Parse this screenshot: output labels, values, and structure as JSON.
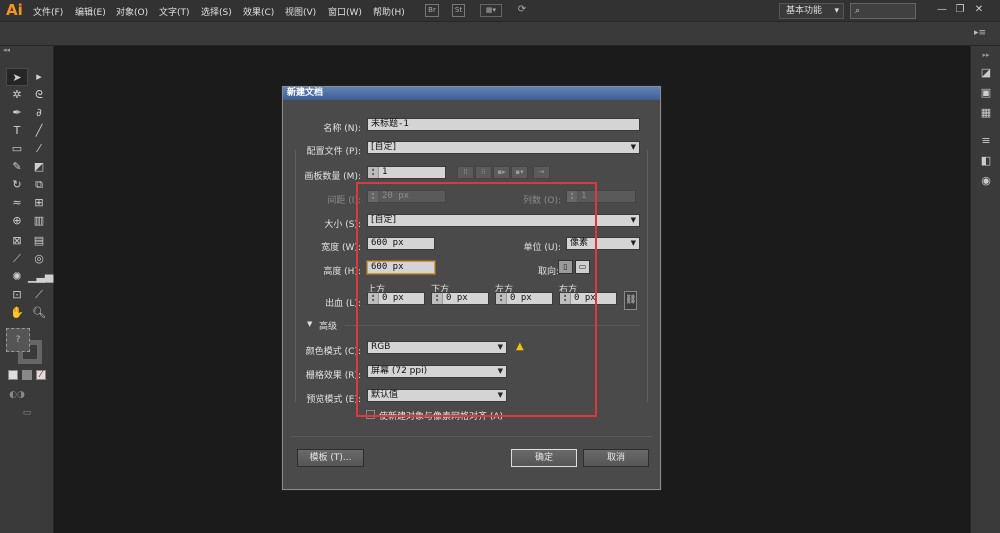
{
  "app": {
    "logo": "Ai",
    "menus": [
      "文件(F)",
      "编辑(E)",
      "对象(O)",
      "文字(T)",
      "选择(S)",
      "效果(C)",
      "视图(V)",
      "窗口(W)",
      "帮助(H)"
    ],
    "toolbar_icons": [
      "Br",
      "St"
    ],
    "workspace": "基本功能",
    "workspace_arrow": "▾",
    "search_icon": "⌕",
    "window_controls": [
      "—",
      "❐",
      "✕"
    ],
    "control_menu": "▸≡"
  },
  "tools": {
    "items": [
      "selection-icon",
      "direct-selection-icon",
      "magic-wand-icon",
      "lasso-icon",
      "pen-icon",
      "curvature-icon",
      "type-icon",
      "line-icon",
      "rectangle-icon",
      "paintbrush-icon",
      "pencil-icon",
      "eraser-icon",
      "rotate-icon",
      "scale-icon",
      "warp-icon",
      "free-transform-icon",
      "shape-builder-icon",
      "perspective-icon",
      "mesh-icon",
      "gradient-icon",
      "eyedropper-icon",
      "blend-icon",
      "symbol-sprayer-icon",
      "graph-icon",
      "artboard-icon",
      "slice-icon",
      "hand-icon",
      "zoom-icon"
    ],
    "fill_label": "?"
  },
  "dialog": {
    "title": "新建文档",
    "name_label": "名称 (N):",
    "name_value": "未标题-1",
    "profile_label": "配置文件 (P):",
    "profile_value": "[自定]",
    "artboards_label": "画板数量 (M):",
    "artboards_value": "1",
    "spacing_label": "间距 (I):",
    "spacing_value": "20 px",
    "columns_label": "列数 (O):",
    "columns_value": "1",
    "size_label": "大小 (S):",
    "size_value": "[自定]",
    "width_label": "宽度 (W):",
    "width_value": "600 px",
    "units_label": "单位 (U):",
    "units_value": "像素",
    "height_label": "高度 (H):",
    "height_value": "600 px",
    "orientation_label": "取向:",
    "bleed_label": "出血 (L):",
    "bleed_top_label": "上方",
    "bleed_bottom_label": "下方",
    "bleed_left_label": "左方",
    "bleed_right_label": "右方",
    "bleed_top_value": "0 px",
    "bleed_bottom_value": "0 px",
    "bleed_left_value": "0 px",
    "bleed_right_value": "0 px",
    "advanced_label": "高级",
    "color_mode_label": "颜色模式 (C):",
    "color_mode_value": "RGB",
    "raster_label": "栅格效果 (R):",
    "raster_value": "屏幕 (72 ppi)",
    "preview_label": "预览模式 (E):",
    "preview_value": "默认值",
    "align_pixel_label": "使新建对象与像素网格对齐 (A)",
    "templates_button": "模板 (T)...",
    "ok_button": "确定",
    "cancel_button": "取消"
  },
  "colors": {
    "highlight": "#e0363c",
    "title_bar": "#4f70a6",
    "focus": "#c89a42"
  }
}
